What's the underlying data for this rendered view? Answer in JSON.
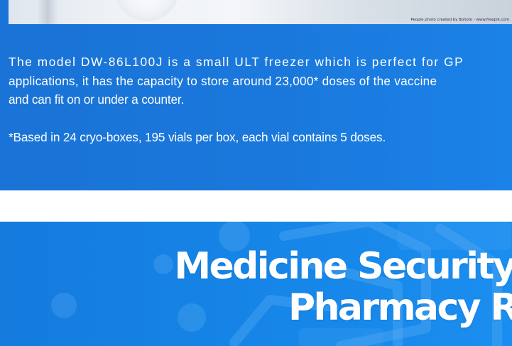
{
  "photo": {
    "credit": "People photo created by 8photo - www.freepik.com"
  },
  "description": {
    "line1": "The model DW-86L100J is a small ULT freezer which is perfect for GP",
    "line2": "applications, it has the capacity to store around 23,000* doses of the vaccine",
    "line3": "and can fit on or under a counter.",
    "footnote": "*Based in 24 cryo-boxes, 195 vials per box, each vial contains 5 doses."
  },
  "hero": {
    "title_line1": "Medicine Security",
    "title_line2": "Pharmacy R"
  },
  "colors": {
    "top_band": "#1a78dc",
    "hero_band": "#1584e6",
    "text": "#ffffff"
  }
}
